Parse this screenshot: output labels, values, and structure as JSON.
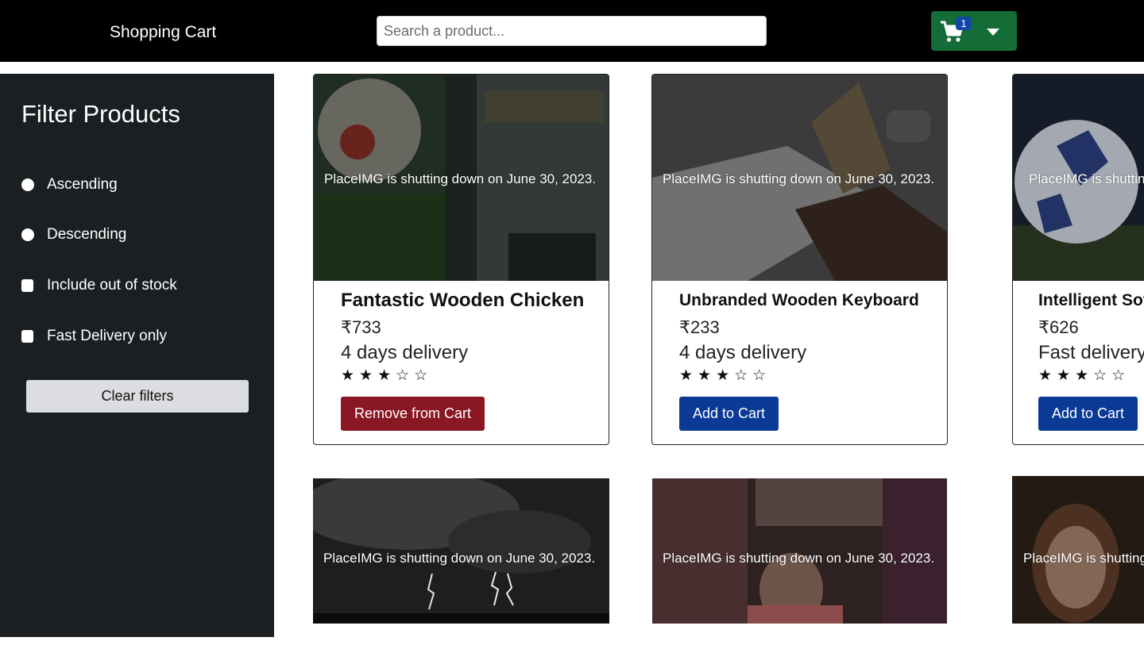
{
  "header": {
    "brand": "Shopping Cart",
    "search_placeholder": "Search a product...",
    "cart_count": "1"
  },
  "sidebar": {
    "title": "Filter Products",
    "options": [
      {
        "label": "Ascending",
        "type": "radio"
      },
      {
        "label": "Descending",
        "type": "radio"
      },
      {
        "label": "Include out of stock",
        "type": "checkbox"
      },
      {
        "label": "Fast Delivery only",
        "type": "checkbox"
      }
    ],
    "clear_label": "Clear filters"
  },
  "image_notice": "PlaceIMG is shutting down on June 30, 2023.",
  "products": [
    {
      "name": "Fantastic Wooden Chicken",
      "currency": "₹",
      "price": "733",
      "delivery": "4 days delivery",
      "rating": "★★★☆☆",
      "action": "Remove from Cart"
    },
    {
      "name": "Unbranded Wooden Keyboard",
      "currency": "₹",
      "price": "233",
      "delivery": "4 days delivery",
      "rating": "★★★☆☆",
      "action": "Add to Cart"
    },
    {
      "name": "Intelligent Soft Ball",
      "currency": "₹",
      "price": "626",
      "delivery": "Fast delivery",
      "rating": "★★★☆☆",
      "action": "Add to Cart"
    }
  ],
  "colors": {
    "header_bg": "#000000",
    "sidebar_bg": "#1b1f22",
    "cart_button": "#146c36",
    "add_button": "#0b3a96",
    "remove_button": "#8a1724"
  }
}
